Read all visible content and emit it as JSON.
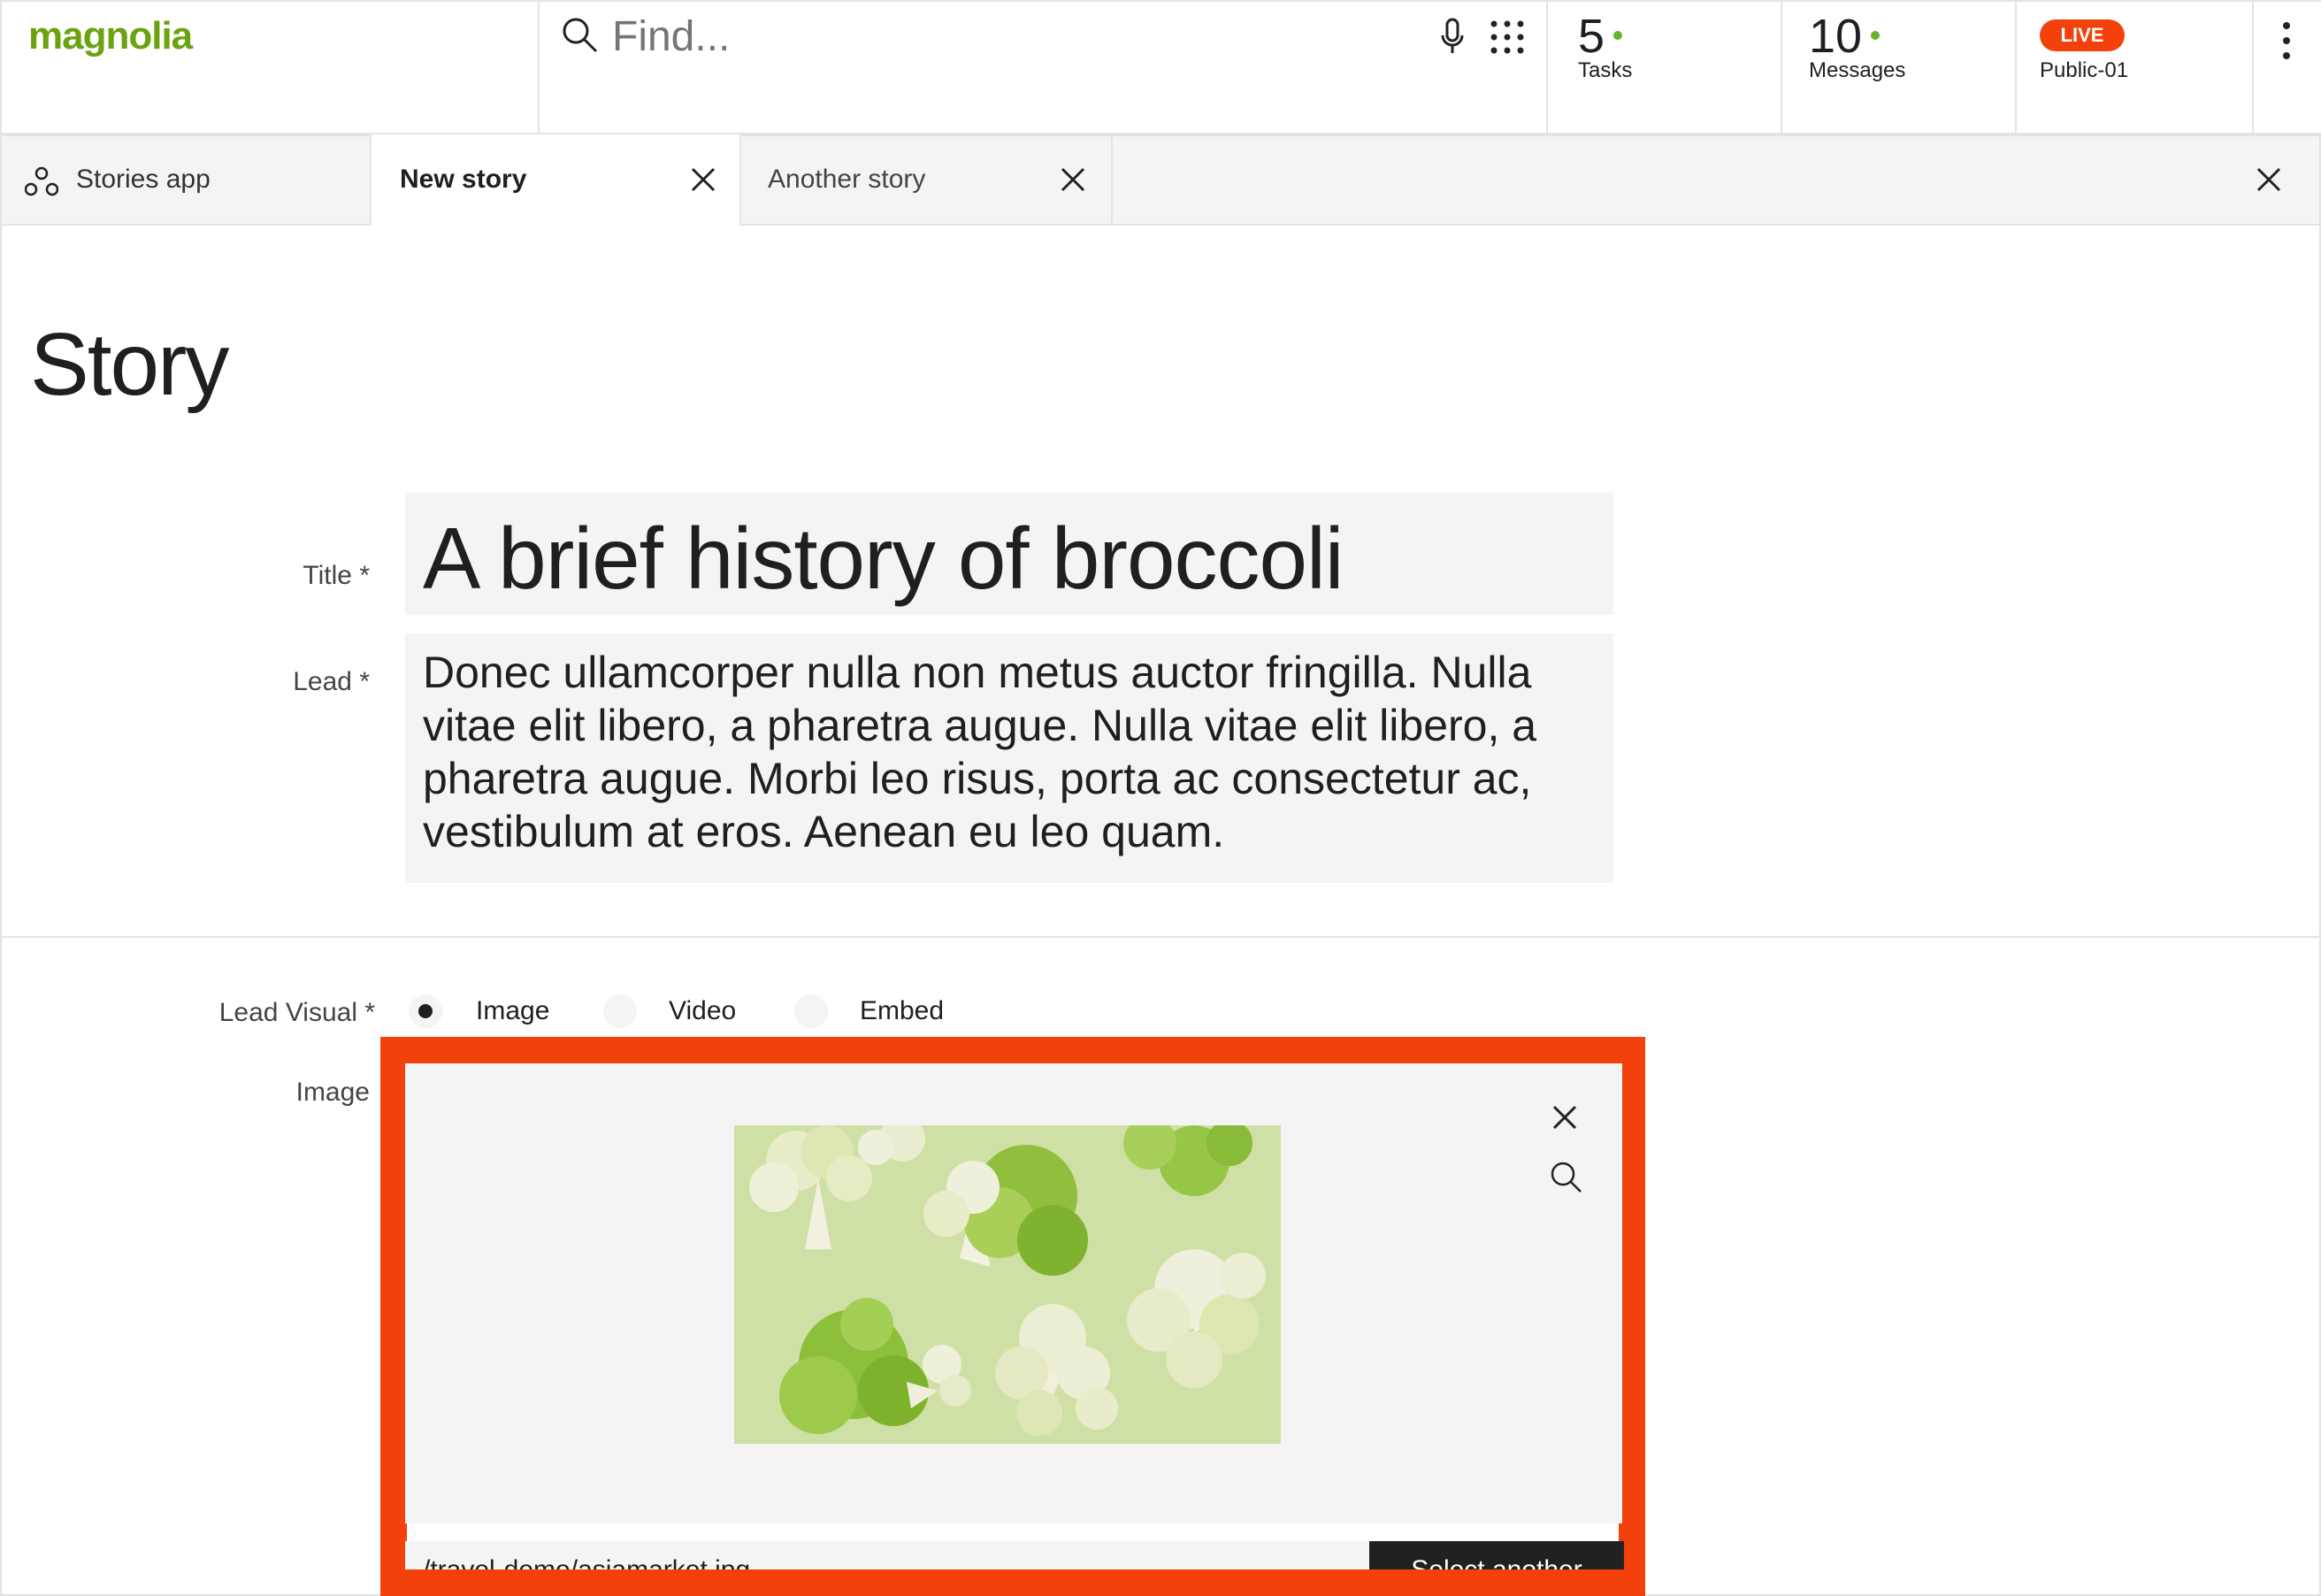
{
  "colors": {
    "brand_green": "#6aa30f",
    "live_badge": "#f2410a",
    "highlight_frame": "#f2410a",
    "field_bg": "#f4f4f4",
    "button_dark": "#212121",
    "status_dot": "#63b32b"
  },
  "header": {
    "logo": "magnolia",
    "search": {
      "placeholder": "Find...",
      "icons": [
        "search-icon",
        "microphone-icon",
        "apps-grid-icon"
      ]
    },
    "tasks": {
      "count": "5",
      "label": "Tasks"
    },
    "messages": {
      "count": "10",
      "label": "Messages"
    },
    "environment": {
      "badge": "LIVE",
      "label": "Public-01"
    },
    "menu_icon": "more-vertical-icon"
  },
  "tabs": {
    "items": [
      {
        "label": "Stories app",
        "icon": "stories-app-icon",
        "closable": false,
        "active": false
      },
      {
        "label": "New story",
        "closable": true,
        "active": true
      },
      {
        "label": "Another story",
        "closable": true,
        "active": false
      }
    ],
    "close_all_icon": "close-icon"
  },
  "page": {
    "title": "Story"
  },
  "form": {
    "title_label": "Title *",
    "title_value": "A brief history of broccoli",
    "lead_label": "Lead *",
    "lead_value": "Donec ullamcorper nulla non metus auctor fringilla. Nulla vitae elit libero, a pharetra augue. Nulla vitae elit libero, a pharetra augue. Morbi leo risus, porta ac consectetur ac, vestibulum at eros. Aenean eu leo quam.",
    "lead_visual_label": "Lead Visual *",
    "lead_visual_options": [
      "Image",
      "Video",
      "Embed"
    ],
    "lead_visual_selected": "Image",
    "image_label": "Image",
    "image_path": "/travel-demo/asiamarket.jpg",
    "select_another": "Select another",
    "image_actions": [
      "close-icon",
      "zoom-icon"
    ]
  }
}
